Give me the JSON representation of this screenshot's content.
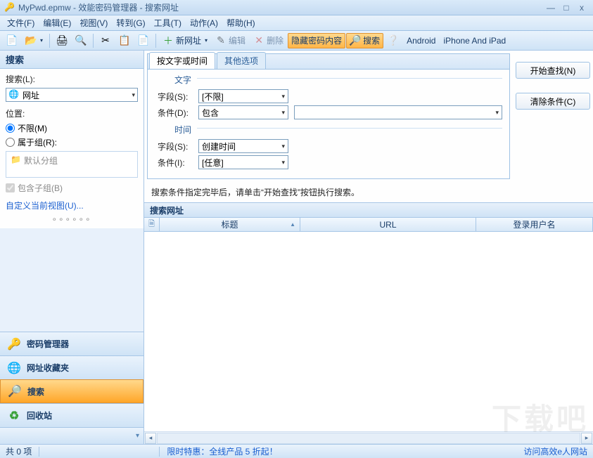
{
  "window": {
    "title": "MyPwd.epmw - 效能密码管理器 - 搜索网址",
    "min": "—",
    "max": "□",
    "close": "x"
  },
  "menus": {
    "file": "文件(F)",
    "edit": "编辑(E)",
    "view": "视图(V)",
    "goto": "转到(G)",
    "tool": "工具(T)",
    "action": "动作(A)",
    "help": "帮助(H)"
  },
  "toolbar": {
    "new_url": "新网址",
    "edit": "编辑",
    "delete": "删除",
    "hide_pwd": "隐藏密码内容",
    "search": "搜索",
    "android": "Android",
    "iphone": "iPhone And iPad"
  },
  "left": {
    "header": "搜索",
    "search_label": "搜索(L):",
    "combo_value": "网址",
    "location_label": "位置:",
    "opt_unlimited": "不限(M)",
    "opt_group": "属于组(R):",
    "default_group": "默认分组",
    "include_sub": "包含子组(B)",
    "custom_view": "自定义当前视图(U)...",
    "nav": {
      "pwd": "密码管理器",
      "fav": "网址收藏夹",
      "search": "搜索",
      "recycle": "回收站"
    }
  },
  "form": {
    "tab_text": "按文字或时间",
    "tab_other": "其他选项",
    "text_section": "文字",
    "time_section": "时间",
    "field_label_s": "字段(S):",
    "field_value_s": "[不限]",
    "cond_label_d": "条件(D):",
    "cond_value_d": "包含",
    "text_input": "",
    "field_label_s2": "字段(S):",
    "field_value_s2": "创建时间",
    "cond_label_i": "条件(I):",
    "cond_value_i": "[任意]",
    "btn_start": "开始查找(N)",
    "btn_clear": "清除条件(C)"
  },
  "hint": "搜索条件指定完毕后，请单击“开始查找”按钮执行搜索。",
  "results": {
    "header": "搜索网址",
    "col_icon": "",
    "col_title": "标题",
    "col_url": "URL",
    "col_user": "登录用户名"
  },
  "status": {
    "count": "共 0 项",
    "promo": "限时特惠：全线产品 5 折起！",
    "visit": "访问高效e人网站"
  },
  "watermark": "下载吧"
}
